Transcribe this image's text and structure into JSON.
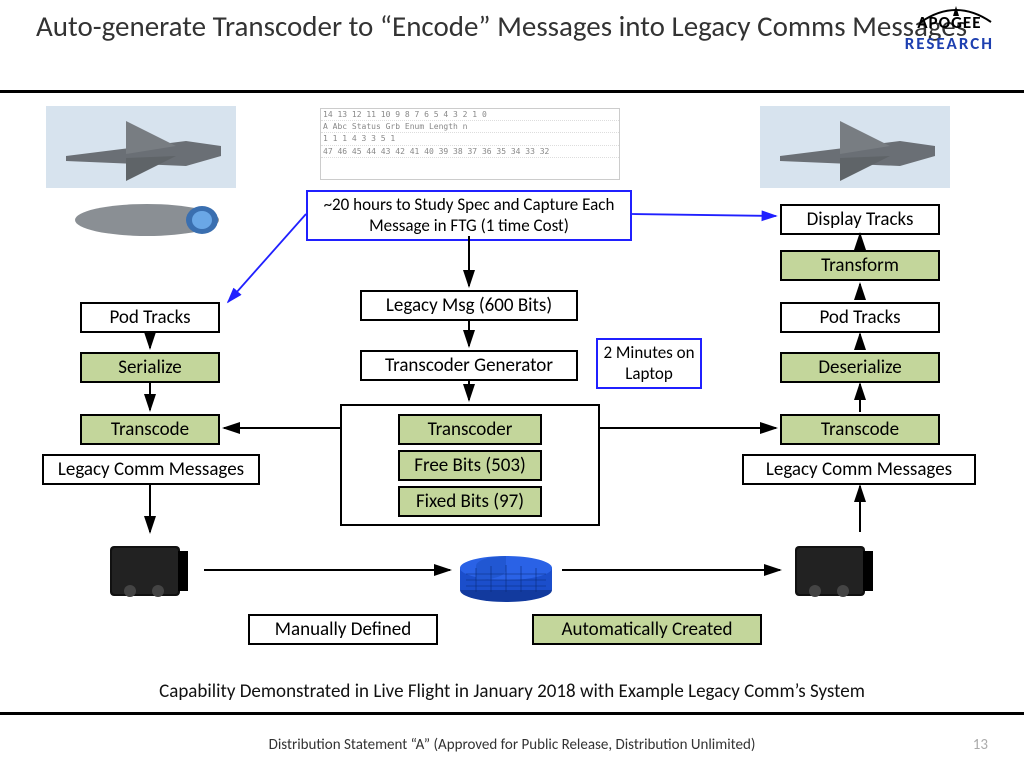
{
  "title": "Auto-generate Transcoder to “Encode” Messages into Legacy Comms Messages",
  "logo": {
    "top": "APOGEE",
    "bot": "RESEARCH"
  },
  "boxes": {
    "costNote": "~20 hours to Study Spec and Capture Each Message in FTG (1 time Cost)",
    "legacyMsg": "Legacy Msg (600 Bits)",
    "transGen": "Transcoder Generator",
    "transcoder": "Transcoder",
    "freeBits": "Free Bits (503)",
    "fixedBits": "Fixed Bits (97)",
    "twoMin": "2 Minutes on Laptop",
    "podTracksL": "Pod Tracks",
    "serialize": "Serialize",
    "transcodeL": "Transcode",
    "legacyCommL": "Legacy Comm Messages",
    "displayTracks": "Display Tracks",
    "transform": "Transform",
    "podTracksR": "Pod Tracks",
    "deserialize": "Deserialize",
    "transcodeR": "Transcode",
    "legacyCommR": "Legacy Comm Messages",
    "manual": "Manually Defined",
    "auto": "Automatically Created"
  },
  "spec": {
    "row1": "14  13  12  11  10  9  8  7  6  5  4  3  2  1  0",
    "row2": "  A    Abc    Status   Grb   Enum   Length   n",
    "row3": " 1 1   1     4      3     3      5       1",
    "row4": "47 46 45 44 43 42 41 40 39 38 37 36 35 34 33 32"
  },
  "caption": "Capability Demonstrated in Live Flight in January 2018 with Example Legacy Comm’s System",
  "footer": "Distribution Statement “A” (Approved for Public Release, Distribution Unlimited)",
  "page": "13"
}
